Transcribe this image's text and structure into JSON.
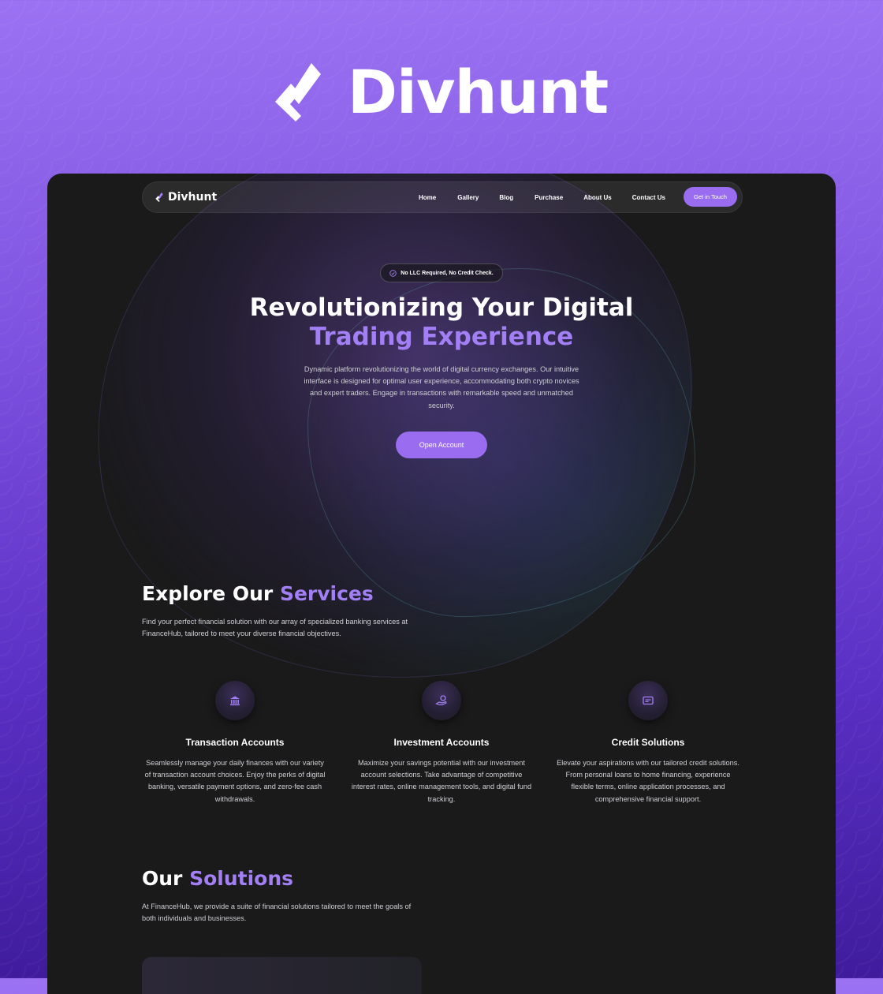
{
  "brand": {
    "name": "Divhunt"
  },
  "nav": {
    "logo": "Divhunt",
    "links": [
      "Home",
      "Gallery",
      "Blog",
      "Purchase",
      "About Us",
      "Contact Us"
    ],
    "cta": "Get in Touch"
  },
  "hero": {
    "badge": "No LLC Required, No Credit Check.",
    "title_line1": "Revolutionizing Your Digital",
    "title_line2": "Trading Experience",
    "description": "Dynamic platform revolutionizing the world of digital currency exchanges. Our intuitive interface is designed for optimal user experience, accommodating both crypto novices and expert traders. Engage in transactions with remarkable speed and unmatched security.",
    "button": "Open Account"
  },
  "services": {
    "title_prefix": "Explore Our",
    "title_accent": "Services",
    "description": "Find your perfect financial solution with our array of specialized banking services at FinanceHub, tailored to meet your diverse financial objectives.",
    "items": [
      {
        "icon": "bank-icon",
        "title": "Transaction Accounts",
        "description": "Seamlessly manage your daily finances with our variety of transaction account choices. Enjoy the perks of digital banking, versatile payment options, and zero-fee cash withdrawals."
      },
      {
        "icon": "hand-coin-icon",
        "title": "Investment Accounts",
        "description": "Maximize your savings potential with our investment account selections. Take advantage of competitive interest rates, online management tools, and digital fund tracking."
      },
      {
        "icon": "credit-card-icon",
        "title": "Credit Solutions",
        "description": "Elevate your aspirations with our tailored credit solutions. From personal loans to home financing, experience flexible terms, online application processes, and comprehensive financial support."
      }
    ]
  },
  "solutions": {
    "title_prefix": "Our",
    "title_accent": "Solutions",
    "description": "At FinanceHub, we provide a suite of financial solutions tailored to meet the goals of both individuals and businesses."
  },
  "colors": {
    "accent": "#9a6cf0",
    "accent_text": "#a37ff5",
    "frame_bg": "#1a1a1b",
    "bg_top": "#9b72f2",
    "bg_bottom": "#3f1c9c"
  }
}
